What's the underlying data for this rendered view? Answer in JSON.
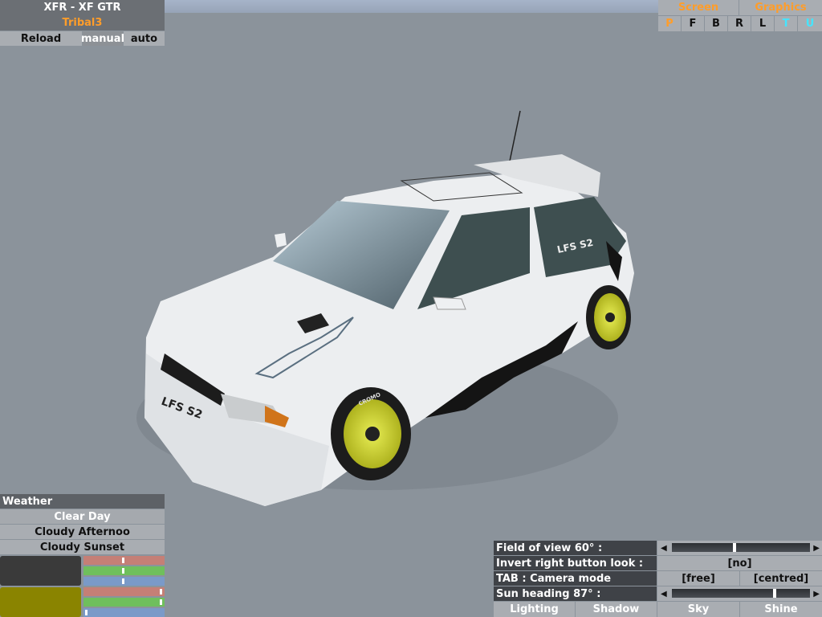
{
  "car": {
    "title": "XFR - XF GTR",
    "skin": "Tribal3",
    "buttons": {
      "reload": "Reload",
      "manual": "manual",
      "auto": "auto"
    }
  },
  "view_tabs": {
    "screen": "Screen",
    "graphics": "Graphics",
    "letters": [
      "P",
      "F",
      "B",
      "R",
      "L",
      "T",
      "U"
    ]
  },
  "weather": {
    "header": "Weather",
    "options": [
      "Clear Day",
      "Cloudy Afternoo",
      "Cloudy Sunset"
    ],
    "swatch1": "#3a3a3a",
    "swatch2": "#8a8400"
  },
  "camera": {
    "fov_label": "Field of view 60° :",
    "invert_label": "Invert right button look :",
    "invert_value": "[no]",
    "tab_label": "TAB : Camera mode",
    "mode_free": "[free]",
    "mode_centred": "[centred]",
    "sun_label": "Sun heading 87° :",
    "tabs": [
      "Lighting",
      "Shadow",
      "Sky",
      "Shine"
    ]
  },
  "plate": "LFS S2",
  "rear_decal": "LFS S2",
  "tire_brand": "CROMO"
}
